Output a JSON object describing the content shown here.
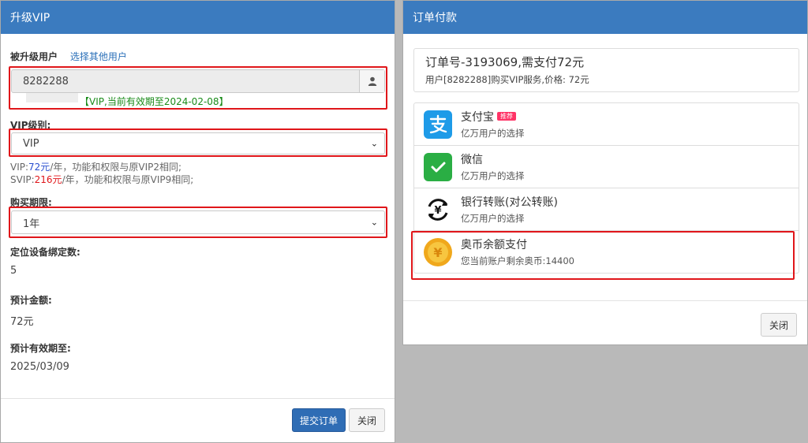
{
  "left": {
    "title": "升级VIP",
    "user_label": "被升级用户",
    "user_link": "选择其他用户",
    "user_id": "8282288",
    "vip_notice_open": "【",
    "vip_notice": "VIP,当前有效期至2024-02-08",
    "vip_notice_close": "】",
    "level_label": "VIP级别:",
    "level_value": "VIP",
    "hint1_prefix": "VIP:",
    "hint1_price": "72元",
    "hint1_suffix": "/年，功能和权限与原VIP2相同;",
    "hint2_prefix": "SVIP:",
    "hint2_price": "216元",
    "hint2_suffix": "/年，功能和权限与原VIP9相同;",
    "period_label": "购买期限:",
    "period_value": "1年",
    "device_label": "定位设备绑定数:",
    "device_value": "5",
    "amount_label": "预计金额:",
    "amount_value": "72元",
    "expire_label": "预计有效期至:",
    "expire_value": "2025/03/09",
    "submit_button": "提交订单",
    "close_button": "关闭"
  },
  "right": {
    "title": "订单付款",
    "order_title": "订单号-3193069,需支付72元",
    "order_sub": "用户[8282288]购买VIP服务,价格: 72元",
    "payments": [
      {
        "name": "支付宝",
        "tag": "推荐",
        "desc": "亿万用户的选择",
        "icon": "alipay-icon",
        "color": "#1e9be8"
      },
      {
        "name": "微信",
        "tag": "",
        "desc": "亿万用户的选择",
        "icon": "wechat-icon",
        "color": "#2aae44"
      },
      {
        "name": "银行转账(对公转账)",
        "tag": "",
        "desc": "亿万用户的选择",
        "icon": "bank-transfer-icon",
        "color": "#111111"
      },
      {
        "name": "奥币余额支付",
        "tag": "",
        "desc": "您当前账户剩余奥币:14400",
        "icon": "coin-icon",
        "color": "#f0a81c"
      }
    ],
    "close_button": "关闭"
  }
}
